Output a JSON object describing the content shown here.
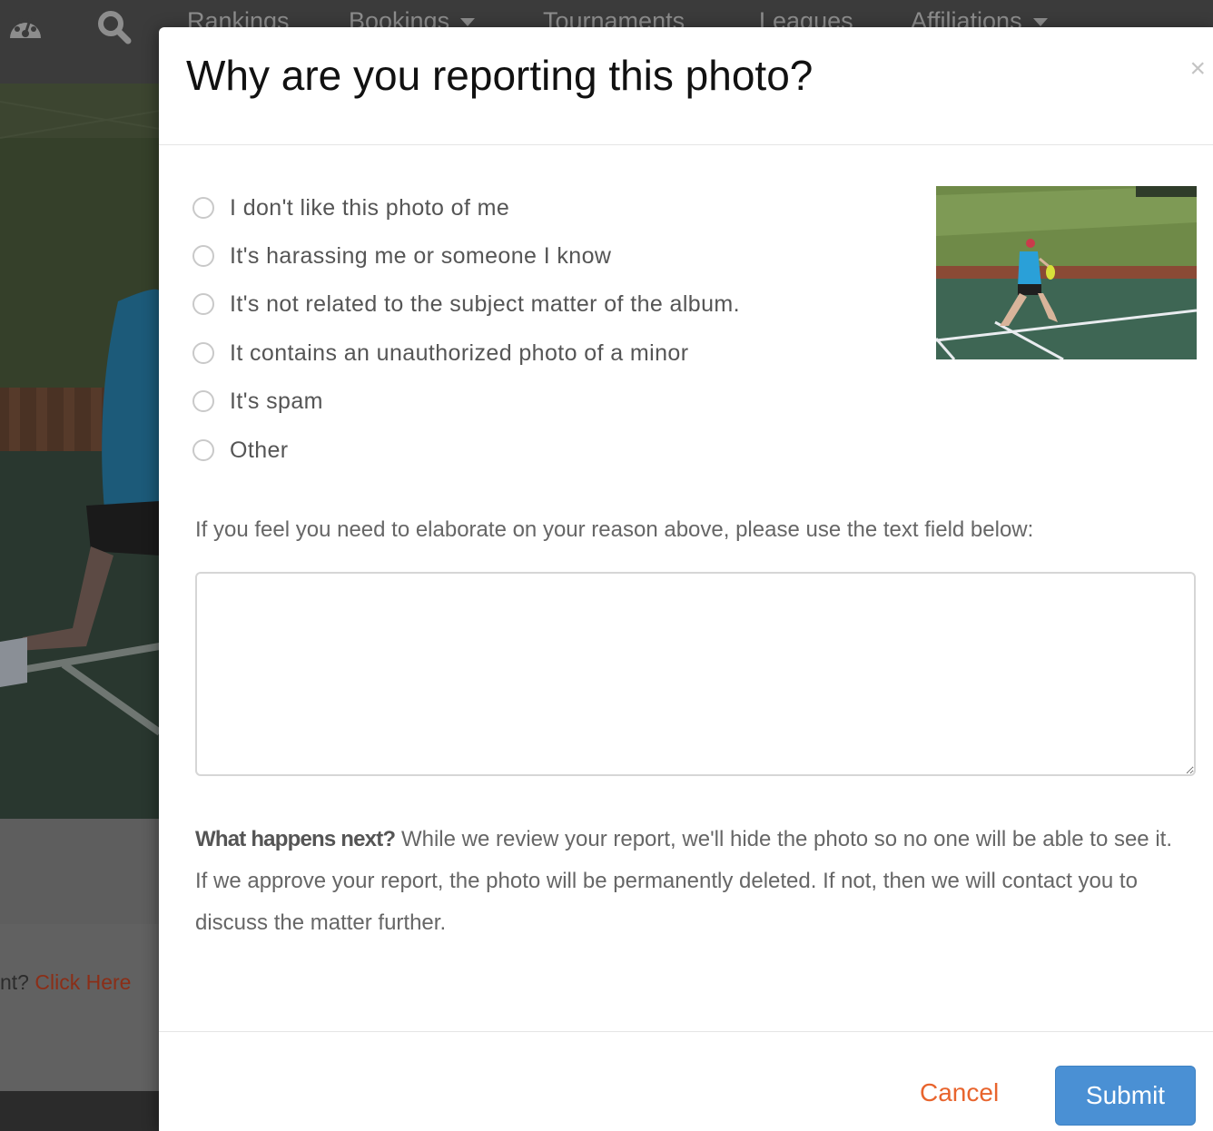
{
  "nav": {
    "items": [
      {
        "label": "Rankings"
      },
      {
        "label": "Bookings"
      },
      {
        "label": "Tournaments"
      },
      {
        "label": "Leagues"
      },
      {
        "label": "Affiliations"
      }
    ],
    "icons": [
      "dashboard-gauge-icon",
      "search-icon",
      "chevron-down-icon"
    ]
  },
  "background": {
    "link_prefix": "nt? ",
    "link_text": "Click Here"
  },
  "modal": {
    "title": "Why are you reporting this photo?",
    "close_symbol": "×",
    "options": [
      {
        "label": "I don't like this photo of me",
        "selected": false
      },
      {
        "label": "It's harassing me or someone I know",
        "selected": false
      },
      {
        "label": "It's not related to the subject matter of the album.",
        "selected": false
      },
      {
        "label": "It contains an unauthorized photo of a minor",
        "selected": false
      },
      {
        "label": "It's spam",
        "selected": false
      },
      {
        "label": "Other",
        "selected": false
      }
    ],
    "elaborate_label": "If you feel you need to elaborate on your reason above, please use the text field below:",
    "textarea_value": "",
    "next_heading": "What happens next?",
    "next_body": " While we review your report, we'll hide the photo so no one will be able to see it. If we approve your report, the photo will be permanently deleted. If not, then we will contact you to discuss the matter further.",
    "cancel_label": "Cancel",
    "submit_label": "Submit"
  },
  "colors": {
    "cancel": "#e8642d",
    "submit_bg": "#4a90d4",
    "link_bg": "#8b2e17",
    "nav_bg": "#3b3b3b"
  }
}
